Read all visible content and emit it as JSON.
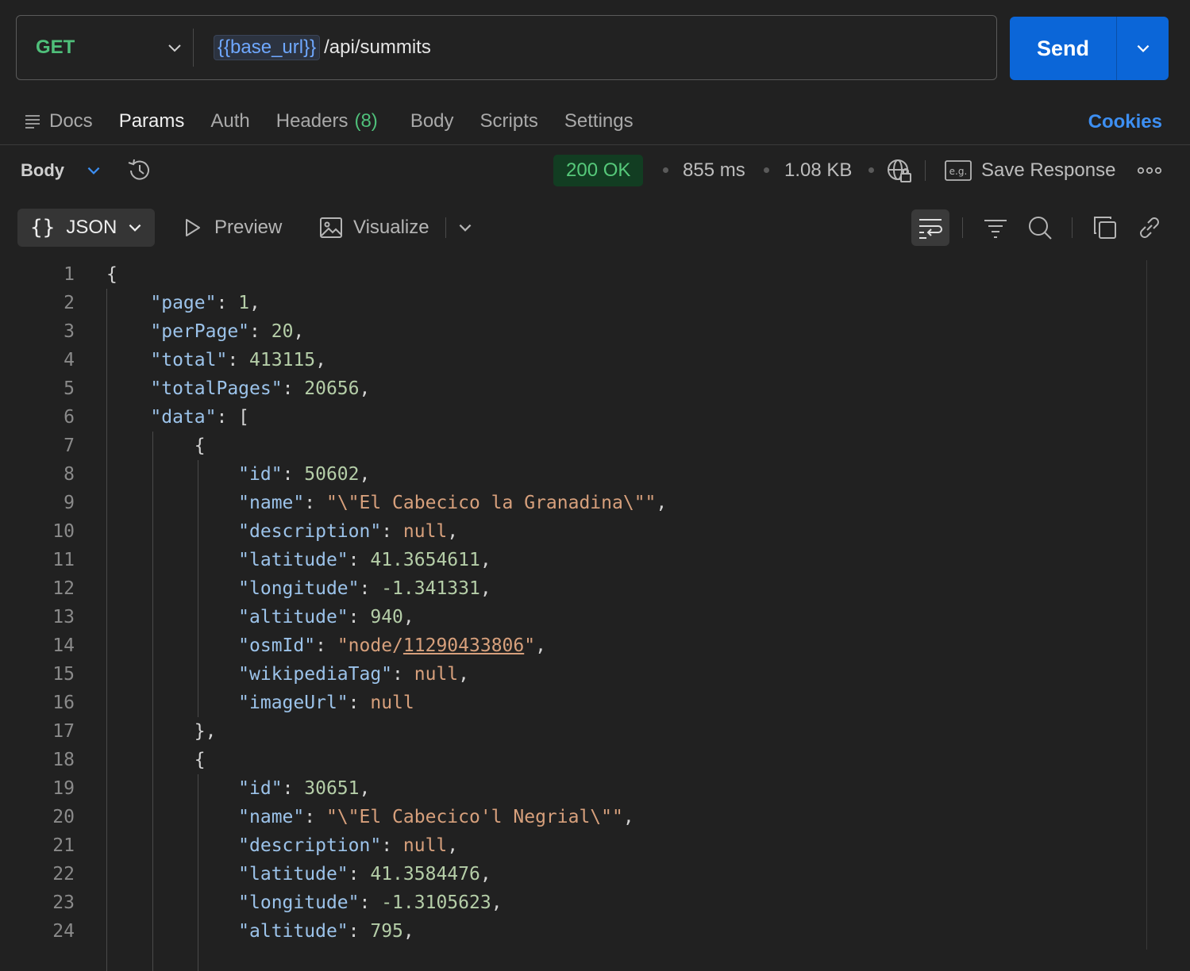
{
  "request": {
    "method": "GET",
    "url_variable": "{{base_url}}",
    "url_path": "/api/summits",
    "send_label": "Send"
  },
  "request_tabs": {
    "docs": "Docs",
    "params": "Params",
    "auth": "Auth",
    "headers": "Headers",
    "headers_count": "(8)",
    "body": "Body",
    "scripts": "Scripts",
    "settings": "Settings",
    "cookies": "Cookies"
  },
  "response": {
    "section_label": "Body",
    "status": "200 OK",
    "time": "855 ms",
    "size": "1.08 KB",
    "save_response": "Save Response"
  },
  "view": {
    "format": "JSON",
    "preview": "Preview",
    "visualize": "Visualize"
  },
  "code": {
    "line_numbers": [
      "1",
      "2",
      "3",
      "4",
      "5",
      "6",
      "7",
      "8",
      "9",
      "10",
      "11",
      "12",
      "13",
      "14",
      "15",
      "16",
      "17",
      "18",
      "19",
      "20",
      "21",
      "22",
      "23",
      "24"
    ],
    "page": "1",
    "perPage": "20",
    "total": "413115",
    "totalPages": "20656",
    "items": [
      {
        "id": "50602",
        "name": "\"\\\"El Cabecico la Granadina\\\"\"",
        "description": "null",
        "latitude": "41.3654611",
        "longitude": "-1.341331",
        "altitude": "940",
        "osmId_prefix": "node/",
        "osmId_link": "11290433806",
        "wikipediaTag": "null",
        "imageUrl": "null"
      },
      {
        "id": "30651",
        "name": "\"\\\"El Cabecico'l Negrial\\\"\"",
        "description": "null",
        "latitude": "41.3584476",
        "longitude": "-1.3105623",
        "altitude": "795"
      }
    ]
  }
}
